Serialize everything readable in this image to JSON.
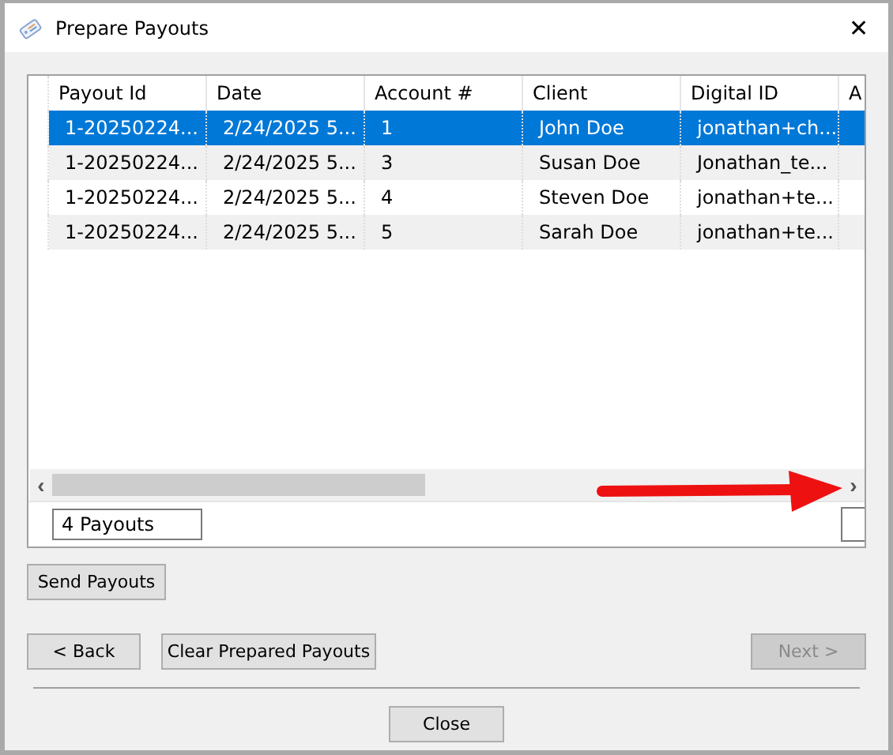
{
  "window": {
    "title": "Prepare Payouts",
    "close": "✕"
  },
  "table": {
    "columns": [
      "Payout Id",
      "Date",
      "Account #",
      "Client",
      "Digital ID",
      "A"
    ],
    "rows": [
      {
        "cells": [
          "1-20250224...",
          "2/24/2025 5...",
          "1",
          "John Doe",
          "jonathan+ch..."
        ],
        "selected": true
      },
      {
        "cells": [
          "1-20250224...",
          "2/24/2025 5...",
          "3",
          "Susan Doe",
          "Jonathan_te..."
        ],
        "selected": false
      },
      {
        "cells": [
          "1-20250224...",
          "2/24/2025 5...",
          "4",
          "Steven Doe",
          "jonathan+te..."
        ],
        "selected": false
      },
      {
        "cells": [
          "1-20250224...",
          "2/24/2025 5...",
          "5",
          "Sarah Doe",
          "jonathan+te..."
        ],
        "selected": false
      }
    ],
    "scroll_left": "‹",
    "scroll_right": "›",
    "summary": "4 Payouts"
  },
  "send_button": {
    "label": "Send Payouts"
  },
  "nav_buttons": [
    {
      "label": "< Back"
    },
    {
      "label": "Clear Prepared Payouts"
    }
  ],
  "next_button": {
    "label": "Next >",
    "disabled": true
  },
  "close_button": "Close"
}
